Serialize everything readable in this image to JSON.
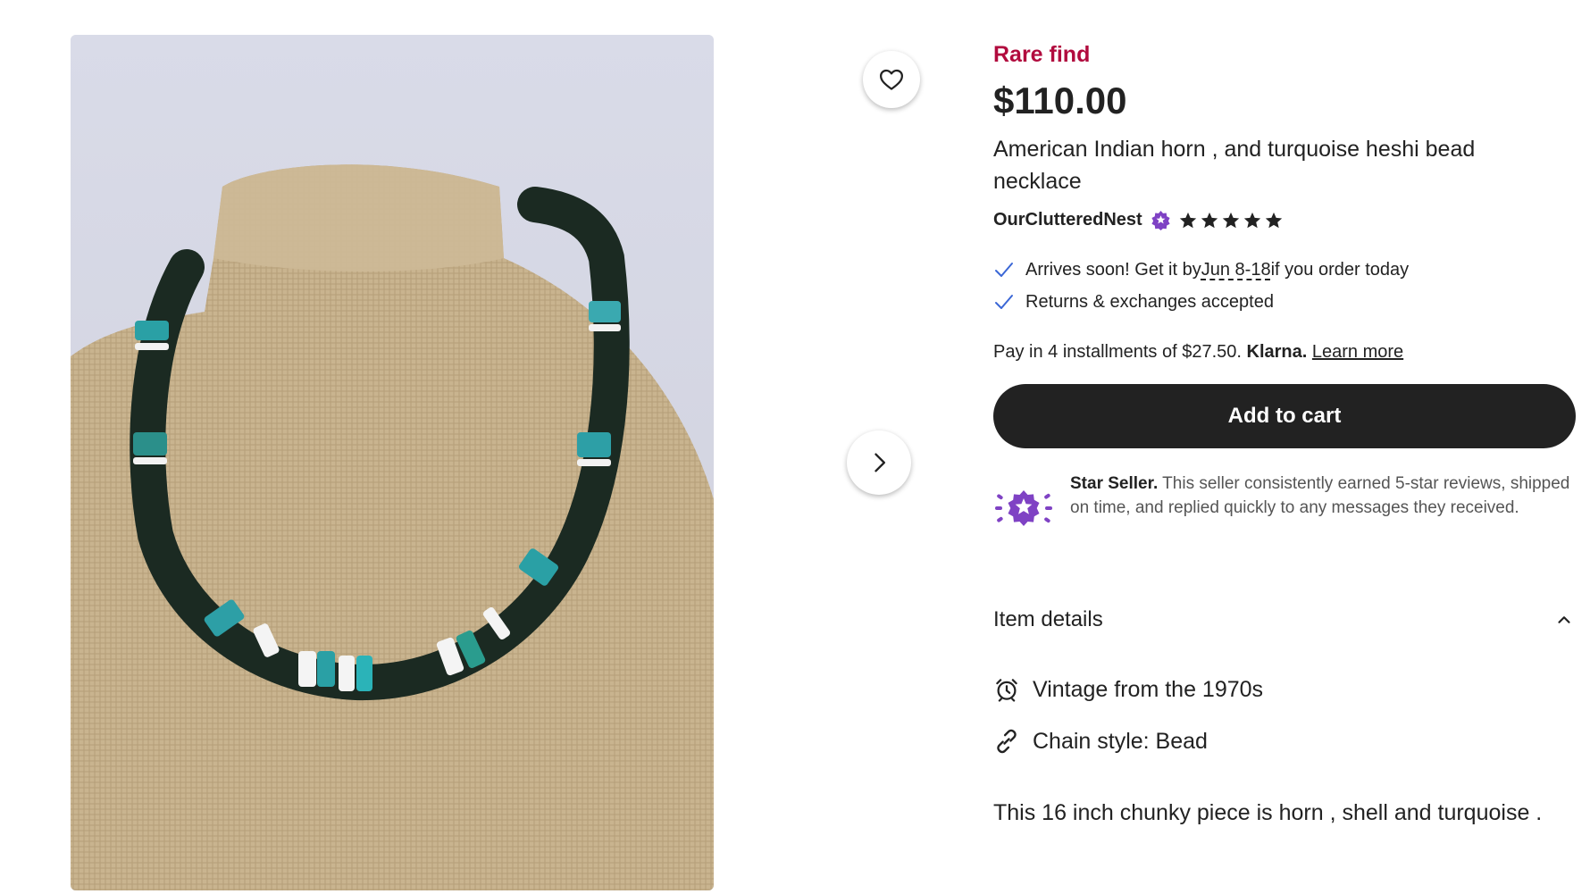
{
  "listing": {
    "badge": "Rare find",
    "price": "$110.00",
    "title": "American Indian horn , and turquoise heshi bead necklace",
    "seller": "OurClutteredNest",
    "rating_stars": 5
  },
  "perks": {
    "arrives_prefix": "Arrives soon! Get it by ",
    "arrives_date": "Jun 8-18",
    "arrives_suffix": " if you order today",
    "returns": "Returns & exchanges accepted"
  },
  "payment": {
    "installments": "Pay in 4 installments of $27.50.",
    "provider": "Klarna.",
    "learn_more": "Learn more"
  },
  "cart": {
    "label": "Add to cart"
  },
  "star_seller": {
    "heading": "Star Seller.",
    "text": " This seller consistently earned 5-star reviews, shipped on time, and replied quickly to any messages they received."
  },
  "details": {
    "heading": "Item details",
    "vintage": "Vintage from the 1970s",
    "chain": "Chain style: Bead"
  },
  "description": "This 16 inch chunky piece is horn , shell and turquoise .",
  "colors": {
    "rare_find": "#b10b3e",
    "button_bg": "#222222",
    "star_seller_purple": "#7f42c4",
    "check_blue": "#3b67d6"
  },
  "icons": [
    "heart-icon",
    "chevron-right-icon",
    "star-seller-badge-icon",
    "star-icon",
    "check-icon",
    "chevron-up-icon",
    "alarm-clock-icon",
    "link-chain-icon"
  ]
}
